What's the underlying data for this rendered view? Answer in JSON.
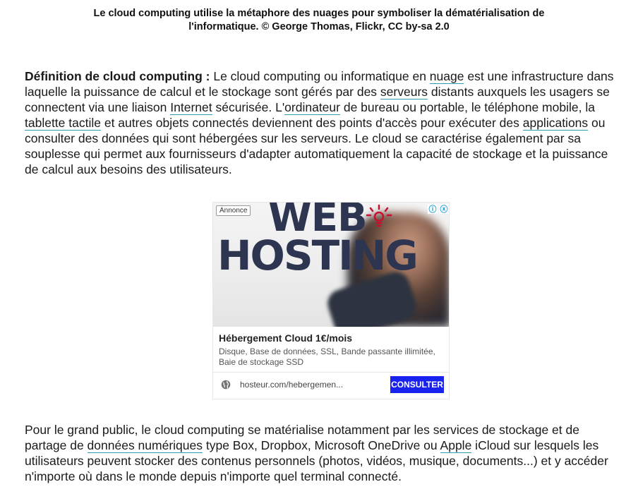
{
  "caption": "Le cloud computing utilise la métaphore des nuages pour symboliser la dématérialisation de l'informatique. © George Thomas, Flickr, CC by-sa 2.0",
  "definition": {
    "term": "Définition de cloud computing :",
    "t1": " Le cloud computing ou informatique en ",
    "link_nuage": "nuage",
    "t2": " est une infrastructure dans laquelle la puissance de calcul et le stockage sont gérés par des ",
    "link_serveurs": "serveurs",
    "t3": " distants auxquels les usagers se connectent via une liaison ",
    "link_internet": "Internet",
    "t4": " sécurisée. L'",
    "link_ordinateur": "ordinateur",
    "t5": " de bureau ou portable, le téléphone mobile, la ",
    "link_tablette": "tablette tactile",
    "t6": " et autres objets connectés deviennent des points d'accès pour exécuter des ",
    "link_applications": "applications",
    "t7": " ou consulter des données qui sont hébergées sur les serveurs. Le cloud se caractérise également par sa souplesse qui permet aux fournisseurs d'adapter automatiquement la capacité de stockage et la puissance de calcul aux besoins des utilisateurs."
  },
  "ad": {
    "label": "Annonce",
    "image_text_1": "WEB",
    "image_text_2": "HOSTING",
    "title": "Hébergement Cloud 1€/mois",
    "description": "Disque, Base de données, SSL, Bande passante illimitée, Baie de stockage SSD",
    "url": "hosteur.com/hebergemen...",
    "button": "CONSULTER",
    "button_color": "#1a22f0"
  },
  "paragraph2": {
    "t1": "Pour le grand public, le cloud computing se matérialise notamment par les services de stockage et de partage de ",
    "link_donnees": "données numériques",
    "t2": " type Box, Dropbox, Microsoft OneDrive ou ",
    "link_apple": "Apple",
    "t3": " iCloud sur lesquels les utilisateurs peuvent stocker des contenus personnels (photos, vidéos, musique, documents...) et y accéder n'importe où dans le monde depuis n'importe quel terminal connecté."
  }
}
